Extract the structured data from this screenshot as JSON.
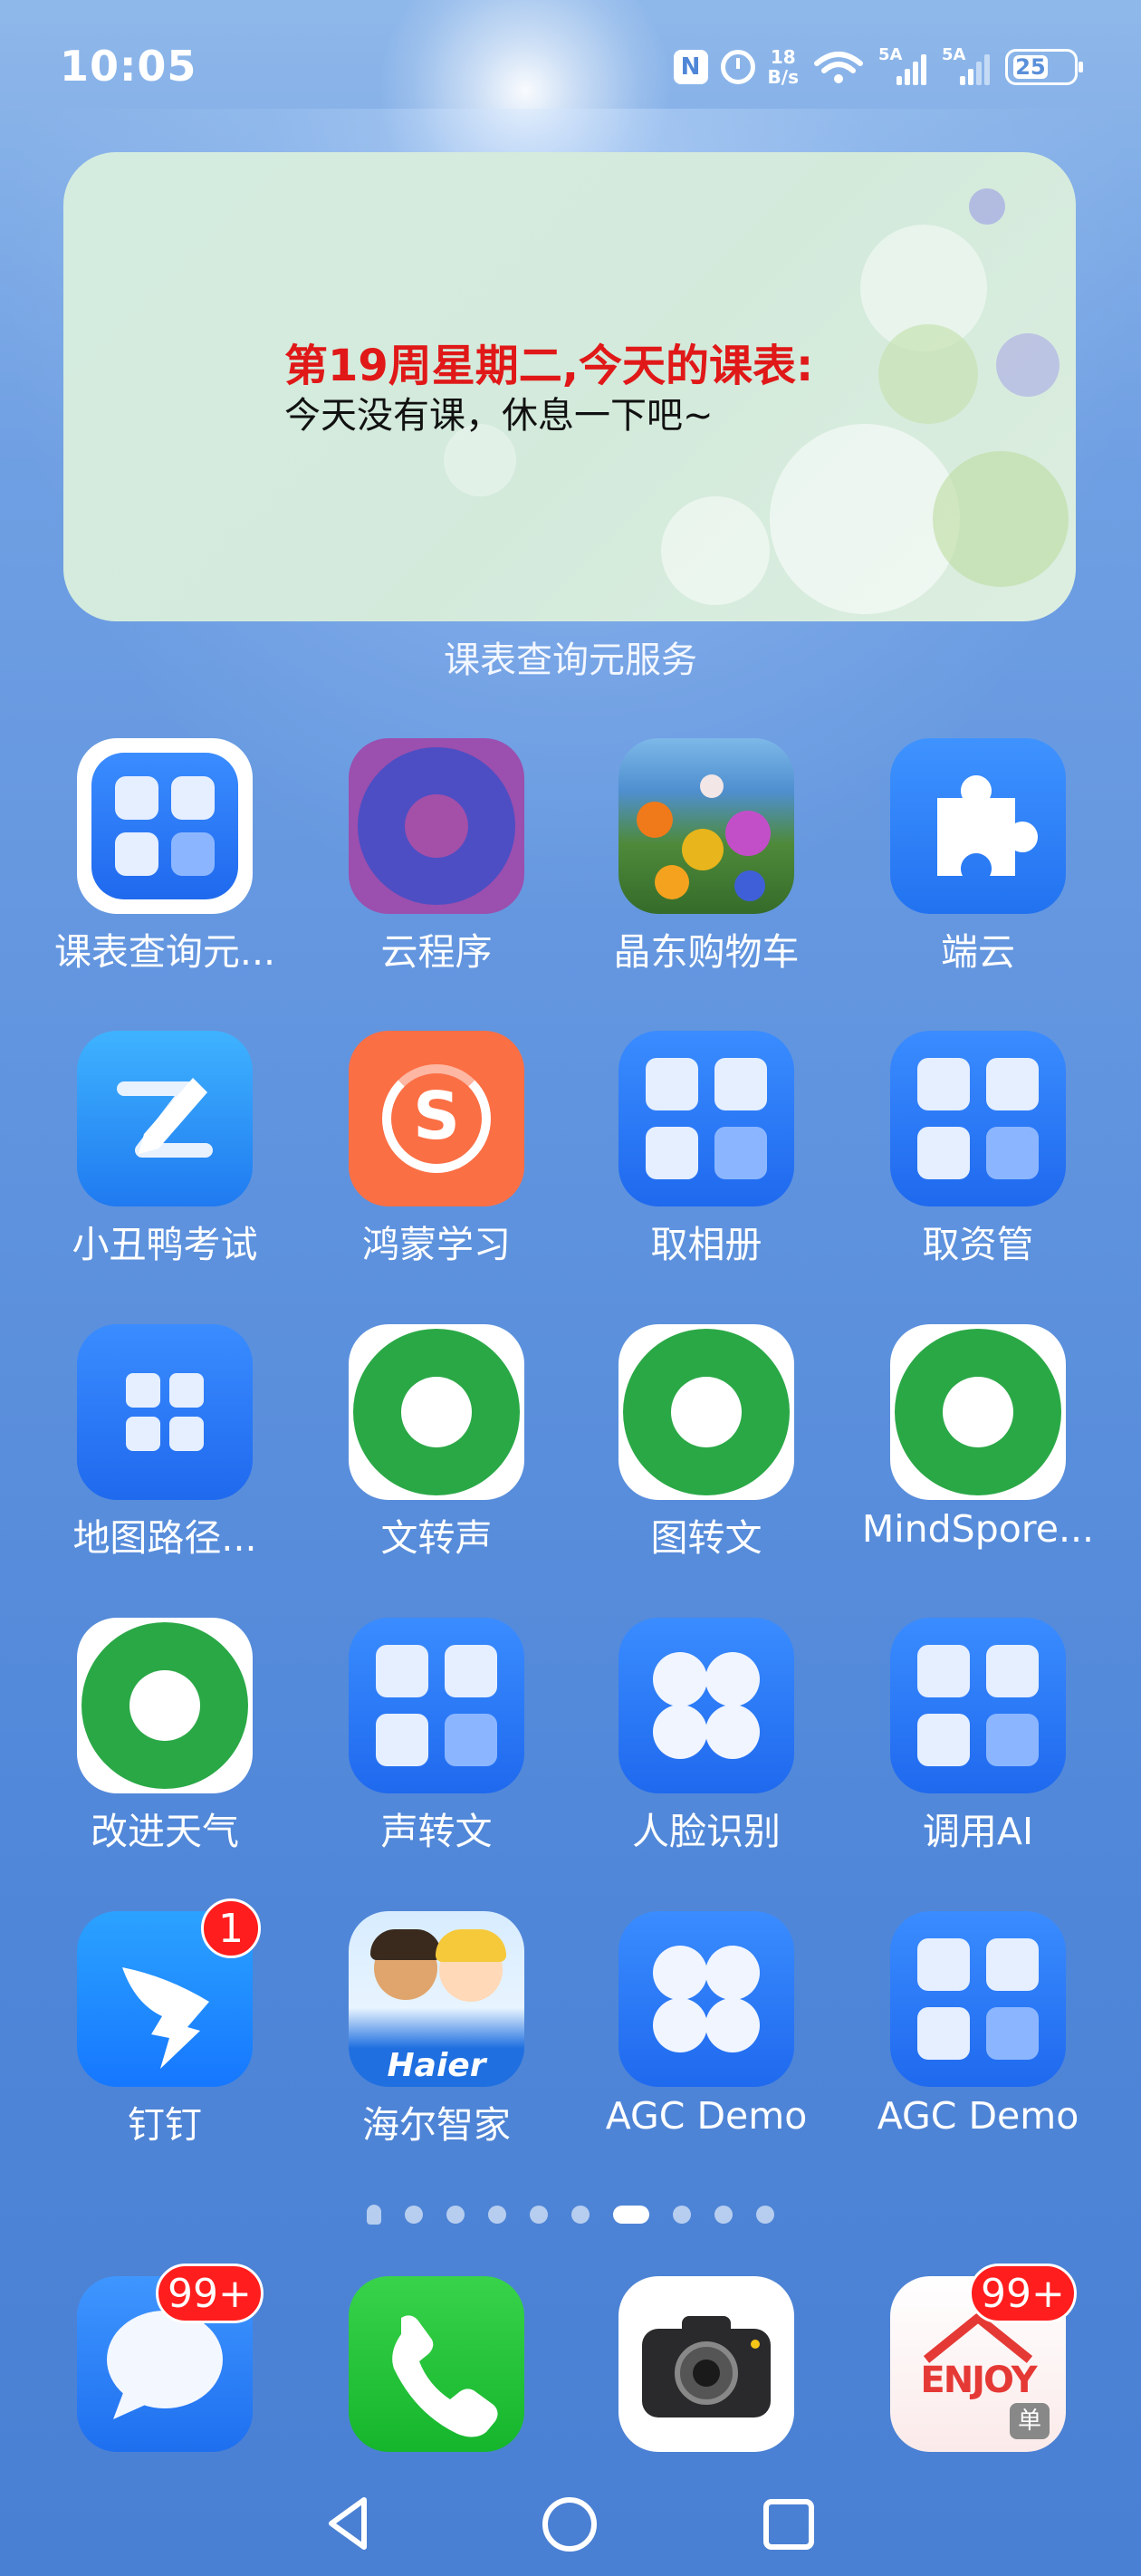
{
  "status_bar": {
    "time": "10:05",
    "nfc_icon": "N",
    "net_speed_value": "18",
    "net_speed_unit": "B/s",
    "signal1_label": "5A",
    "signal2_label": "5A",
    "battery": "25"
  },
  "widget": {
    "title": "第19周星期二,今天的课表:",
    "message": "今天没有课，休息一下吧~",
    "caption": "课表查询元服务"
  },
  "apps": [
    {
      "label": "课表查询元...",
      "icon": "app-grid-icon"
    },
    {
      "label": "云程序",
      "icon": "purple-circle-icon"
    },
    {
      "label": "晶东购物车",
      "icon": "flowers-photo-icon"
    },
    {
      "label": "端云",
      "icon": "puzzle-icon"
    },
    {
      "label": "小丑鸭考试",
      "icon": "pencil-icon"
    },
    {
      "label": "鸿蒙学习",
      "icon": "s-logo-icon"
    },
    {
      "label": "取相册",
      "icon": "app-grid-icon"
    },
    {
      "label": "取资管",
      "icon": "app-grid-icon"
    },
    {
      "label": "地图路径...",
      "icon": "app-grid-icon"
    },
    {
      "label": "文转声",
      "icon": "green-ring-icon"
    },
    {
      "label": "图转文",
      "icon": "green-ring-icon"
    },
    {
      "label": "MindSpore...",
      "icon": "green-ring-icon"
    },
    {
      "label": "改进天气",
      "icon": "green-ring-icon"
    },
    {
      "label": "声转文",
      "icon": "app-grid-icon"
    },
    {
      "label": "人脸识别",
      "icon": "clover-icon"
    },
    {
      "label": "调用AI",
      "icon": "app-grid-icon"
    },
    {
      "label": "钉钉",
      "icon": "dingtalk-icon",
      "badge": "1"
    },
    {
      "label": "海尔智家",
      "icon": "haier-icon",
      "brand": "Haier"
    },
    {
      "label": "AGC Demo",
      "icon": "clover-icon"
    },
    {
      "label": "AGC Demo",
      "icon": "app-grid-icon"
    }
  ],
  "dock": [
    {
      "name": "messages",
      "icon": "message-bubble-icon",
      "badge": "99+"
    },
    {
      "name": "phone",
      "icon": "phone-icon"
    },
    {
      "name": "camera",
      "icon": "camera-icon"
    },
    {
      "name": "enjoy",
      "icon": "enjoy-icon",
      "badge": "99+",
      "sign": "ENJOY",
      "tag": "单"
    }
  ],
  "page_indicator": {
    "total": 10,
    "active": 6
  },
  "colors": {
    "accent_blue": "#1f69ee",
    "badge_red": "#ff1d1d",
    "ring_green": "#2aa846",
    "widget_title_red": "#e01818"
  }
}
